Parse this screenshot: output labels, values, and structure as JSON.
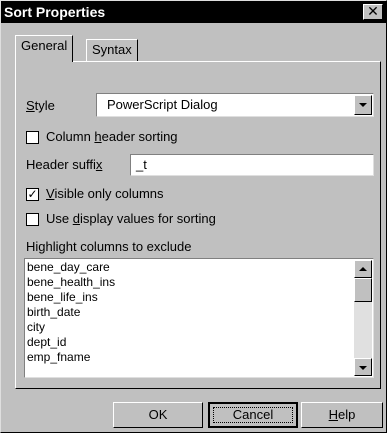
{
  "window": {
    "title": "Sort Properties",
    "close_glyph": "✕"
  },
  "tabs": [
    {
      "label": "General",
      "active": true
    },
    {
      "label": "Syntax",
      "active": false
    }
  ],
  "style": {
    "label_pre": "",
    "label_u": "S",
    "label_post": "tyle",
    "value": "PowerScript Dialog"
  },
  "column_header_sorting": {
    "checked": false,
    "label_pre": "Column ",
    "label_u": "h",
    "label_post": "eader sorting"
  },
  "header_suffix": {
    "label_pre": "Header suffi",
    "label_u": "x",
    "label_post": "",
    "value": "_t"
  },
  "visible_only_columns": {
    "checked": true,
    "check_glyph": "✓",
    "label_pre": "",
    "label_u": "V",
    "label_post": "isible only columns"
  },
  "use_display_values": {
    "checked": false,
    "label_pre": "Use ",
    "label_u": "d",
    "label_post": "isplay values for sorting"
  },
  "highlight_label": "Highlight columns to exclude",
  "columns": [
    "bene_day_care",
    "bene_health_ins",
    "bene_life_ins",
    "birth_date",
    "city",
    "dept_id",
    "emp_fname"
  ],
  "buttons": {
    "ok": "OK",
    "cancel": "Cancel",
    "help_u": "H",
    "help_post": "elp"
  },
  "colors": {
    "face": "#c0c0c0",
    "titlebar": "#000000",
    "field": "#ffffff"
  }
}
